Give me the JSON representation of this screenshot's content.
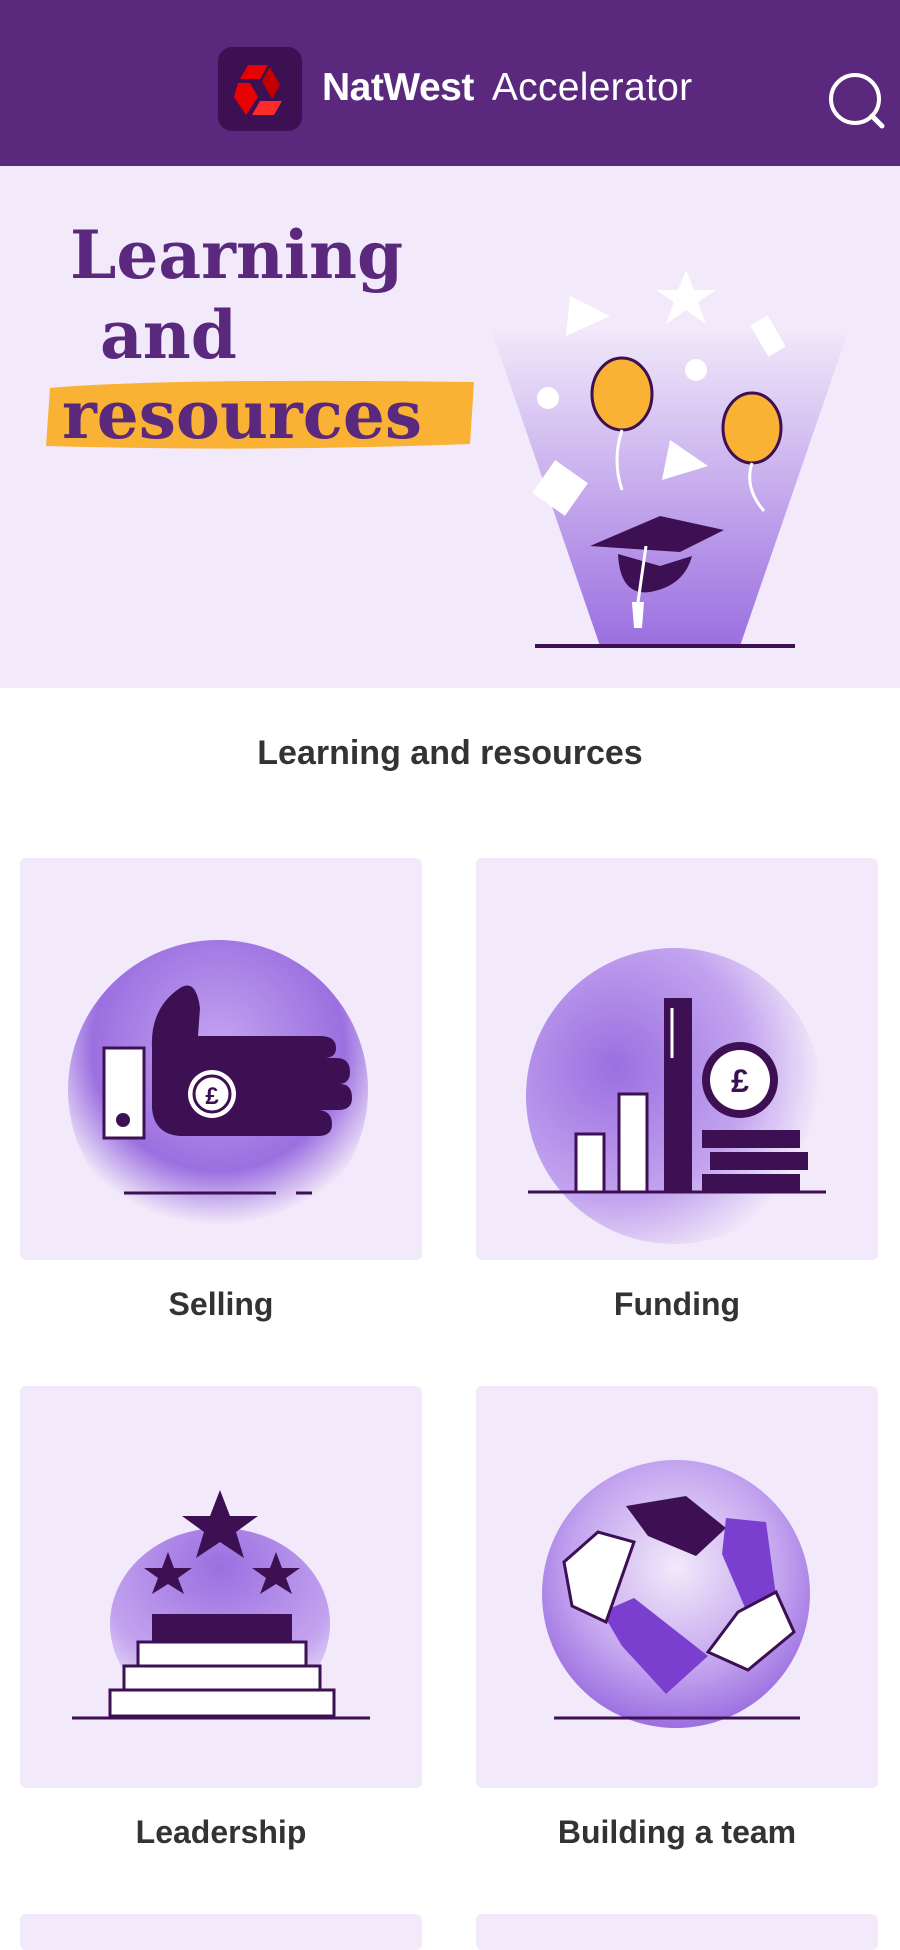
{
  "header": {
    "brand_name": "NatWest",
    "brand_product": "Accelerator",
    "search_icon": "search-icon",
    "background_color": "#5a287d"
  },
  "hero": {
    "title_line1": "Learning",
    "title_line2": "and",
    "title_line3": "resources",
    "background_color": "#f2eafa",
    "highlight_color": "#f9b233"
  },
  "section": {
    "title": "Learning and resources"
  },
  "cards": [
    {
      "label": "Selling",
      "icon": "hand-coin-icon"
    },
    {
      "label": "Funding",
      "icon": "bar-chart-coins-icon"
    },
    {
      "label": "Leadership",
      "icon": "podium-stars-icon"
    },
    {
      "label": "Building a team",
      "icon": "linked-hands-icon"
    }
  ],
  "colors": {
    "brand_purple": "#5a287d",
    "dark_purple": "#3c1053",
    "accent_purple": "#7b3fd0",
    "card_background": "#f2eafa",
    "natwest_red": "#e90000"
  }
}
